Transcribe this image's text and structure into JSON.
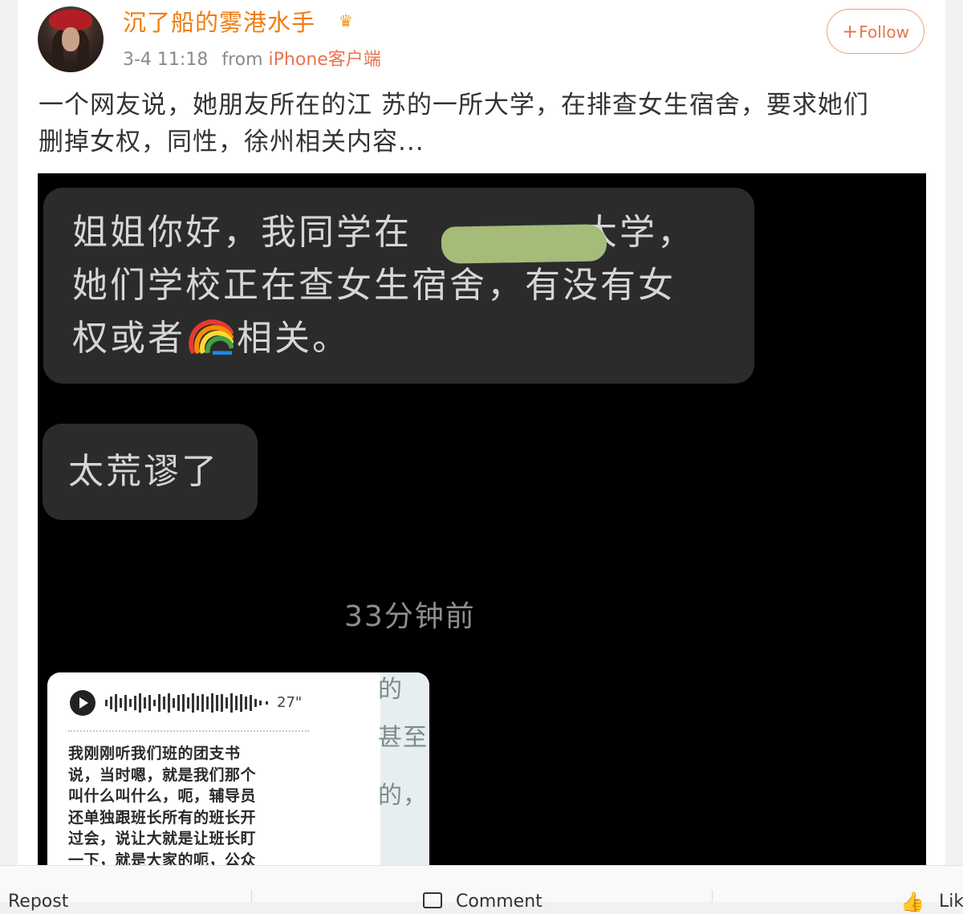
{
  "post": {
    "username": "沉了船的雾港水手",
    "timestamp": "3-4 11:18",
    "from_label": "from",
    "source": "iPhone客户端",
    "follow_label": "Follow",
    "text_line1": "一个网友说，她朋友所在的江 苏的一所大学，在排查女生宿舍，要求她们",
    "text_line2": "删掉女权，同性，徐州相关内容..."
  },
  "screenshot": {
    "bubble1_line1a": "姐姐你好，我同学在",
    "bubble1_line1b": "大学，",
    "bubble1_line2": "她们学校正在查女生宿舍，有没有女",
    "bubble1_line3a": "权或者",
    "bubble1_line3b": "相关。",
    "bubble2_text": "太荒谬了",
    "time_ago": "33分钟前",
    "voice_duration": "27\"",
    "transcript": [
      "我刚刚听我们班的团支书",
      "说，当时嗯，就是我们那个",
      "叫什么叫什么，呃，辅导员",
      "还单独跟班长所有的班长开",
      "过会，说让大就是让班长盯",
      "一下，就是大家的呃，公众"
    ],
    "ghost_chars": [
      "的",
      "甚至",
      "的，"
    ]
  },
  "actions": {
    "repost_label": "Repost",
    "comment_label": "Comment",
    "like_label": "Like"
  },
  "colors": {
    "username": "#f07c0f",
    "accent": "#eb7350",
    "redaction": "#a4bb7a"
  },
  "icons": [
    "crown-badge-icon",
    "plus-icon",
    "rainbow-emoji-icon",
    "play-icon",
    "comment-icon",
    "like-icon"
  ]
}
